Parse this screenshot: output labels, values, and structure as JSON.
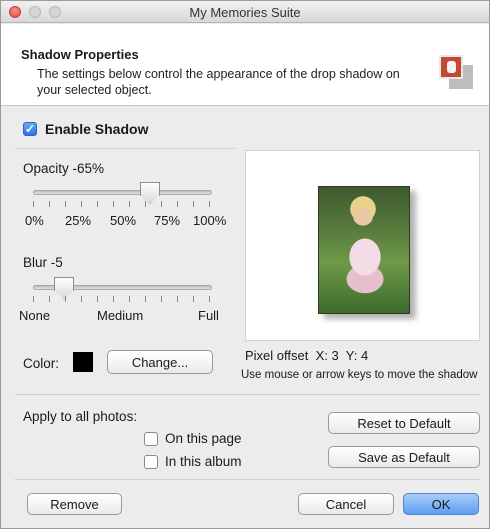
{
  "window": {
    "title": "My Memories Suite"
  },
  "header": {
    "title": "Shadow Properties",
    "description": "The settings below control the appearance of the drop shadow on your selected object."
  },
  "enable_shadow": {
    "label": "Enable Shadow",
    "checked": true
  },
  "opacity": {
    "label": "Opacity -65%",
    "value_percent": 65,
    "tick_labels": [
      "0%",
      "25%",
      "50%",
      "75%",
      "100%"
    ]
  },
  "blur": {
    "label": "Blur -5",
    "value": 5,
    "tick_labels": [
      "None",
      "Medium",
      "Full"
    ]
  },
  "color": {
    "label": "Color:",
    "value": "#000000",
    "change_button": "Change..."
  },
  "preview": {
    "pixel_offset_label": "Pixel offset",
    "x_label": "X:",
    "x_value": "3",
    "y_label": "Y:",
    "y_value": "4",
    "hint": "Use mouse or arrow keys to move the shadow"
  },
  "apply": {
    "label": "Apply to all photos:",
    "on_this_page": "On this page",
    "in_this_album": "In this album"
  },
  "buttons": {
    "reset": "Reset to Default",
    "save_default": "Save as Default",
    "remove": "Remove",
    "cancel": "Cancel",
    "ok": "OK"
  }
}
